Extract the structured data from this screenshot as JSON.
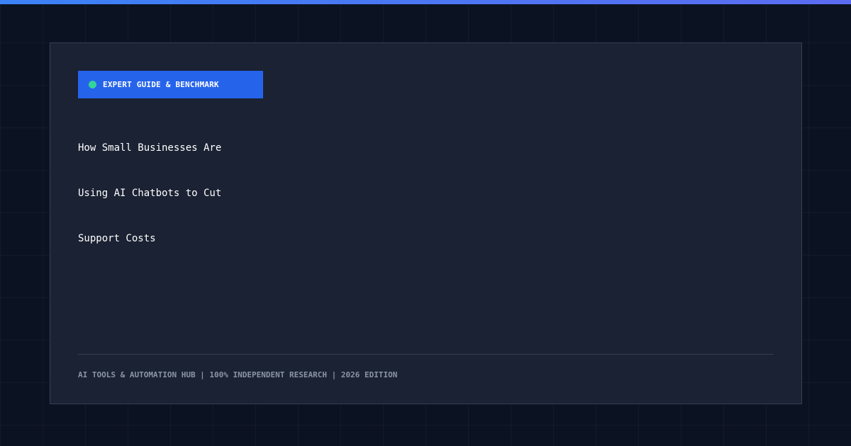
{
  "theme": {
    "background": "#0b1222",
    "card": "#1a2233",
    "accent": "#2563eb",
    "top_bar_start": "#3b82f6",
    "top_bar_end": "#5c6cf2",
    "badge_dot": "#34d399",
    "footer_text": "#8b95a7"
  },
  "badge": {
    "icon": "status-dot-icon",
    "label": "EXPERT GUIDE & BENCHMARK"
  },
  "headline": {
    "lines": [
      "How Small Businesses Are",
      "Using AI Chatbots to Cut",
      "Support Costs"
    ]
  },
  "footer": {
    "text": "AI TOOLS & AUTOMATION HUB | 100% INDEPENDENT RESEARCH | 2026 EDITION"
  }
}
